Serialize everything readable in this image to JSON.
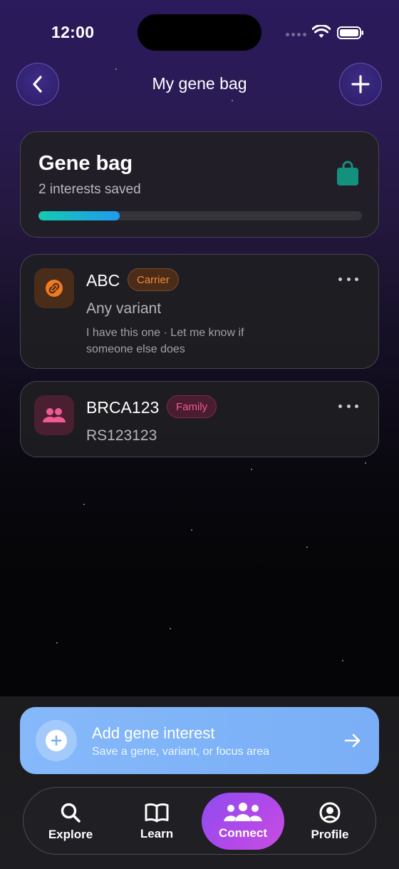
{
  "status_bar": {
    "time": "12:00"
  },
  "header": {
    "title": "My gene bag",
    "back_icon": "chevron-left-icon",
    "add_icon": "plus-icon"
  },
  "summary": {
    "title": "Gene bag",
    "subtitle": "2 interests saved",
    "icon": "shopping-bag-icon",
    "progress": 0.25,
    "colors": {
      "icon": "#14907e",
      "progress_start": "#15c9b0",
      "progress_end": "#1e9bf0"
    }
  },
  "genes": [
    {
      "name": "ABC",
      "tag": "Carrier",
      "variant": "Any variant",
      "note": "I have this one · Let me know if someone else does",
      "icon": "link-icon",
      "color": "#f28a3a"
    },
    {
      "name": "BRCA123",
      "tag": "Family",
      "variant": "RS123123",
      "icon": "people-icon",
      "color": "#ef5a92"
    }
  ],
  "cta": {
    "title": "Add gene interest",
    "subtitle": "Save a gene, variant, or focus area",
    "icon": "plus-circle-icon",
    "arrow_icon": "arrow-right-icon",
    "color": "#80b4f8"
  },
  "tabs": [
    {
      "label": "Explore",
      "icon": "search-icon"
    },
    {
      "label": "Learn",
      "icon": "book-icon"
    },
    {
      "label": "Connect",
      "icon": "community-icon",
      "active": true
    },
    {
      "label": "Profile",
      "icon": "user-circle-icon"
    }
  ]
}
